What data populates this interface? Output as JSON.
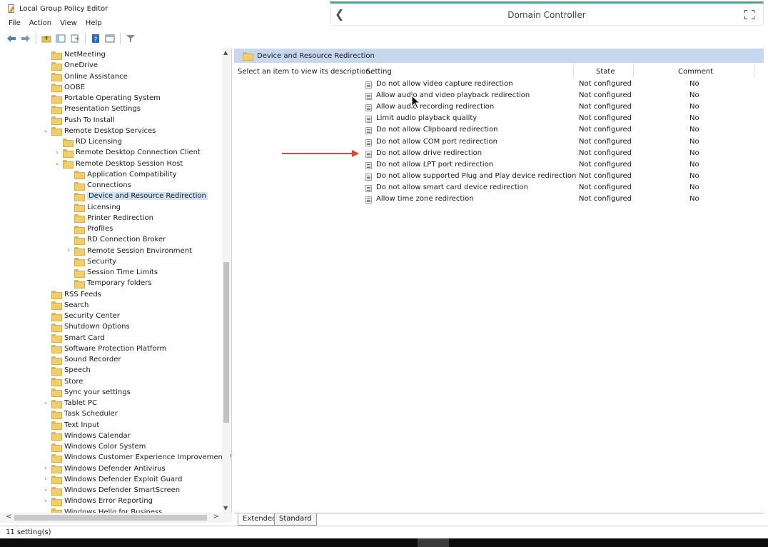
{
  "window": {
    "title": "Local Group Policy Editor"
  },
  "menu": [
    "File",
    "Action",
    "View",
    "Help"
  ],
  "remote_session": {
    "title": "Domain Controller"
  },
  "tree": {
    "items": [
      {
        "label": "NetMeeting",
        "expander": ""
      },
      {
        "label": "OneDrive",
        "expander": ""
      },
      {
        "label": "Online Assistance",
        "expander": ""
      },
      {
        "label": "OOBE",
        "expander": ""
      },
      {
        "label": "Portable Operating System",
        "expander": ""
      },
      {
        "label": "Presentation Settings",
        "expander": ""
      },
      {
        "label": "Push To Install",
        "expander": ""
      },
      {
        "label": "Remote Desktop Services",
        "expander": "⌄"
      },
      {
        "label": "RD Licensing",
        "expander": ""
      },
      {
        "label": "Remote Desktop Connection Client",
        "expander": "›"
      },
      {
        "label": "Remote Desktop Session Host",
        "expander": "⌄"
      },
      {
        "label": "Application Compatibility",
        "expander": ""
      },
      {
        "label": "Connections",
        "expander": ""
      },
      {
        "label": "Device and Resource Redirection",
        "expander": "",
        "selected": true
      },
      {
        "label": "Licensing",
        "expander": ""
      },
      {
        "label": "Printer Redirection",
        "expander": ""
      },
      {
        "label": "Profiles",
        "expander": ""
      },
      {
        "label": "RD Connection Broker",
        "expander": ""
      },
      {
        "label": "Remote Session Environment",
        "expander": "›"
      },
      {
        "label": "Security",
        "expander": ""
      },
      {
        "label": "Session Time Limits",
        "expander": ""
      },
      {
        "label": "Temporary folders",
        "expander": ""
      },
      {
        "label": "RSS Feeds",
        "expander": ""
      },
      {
        "label": "Search",
        "expander": ""
      },
      {
        "label": "Security Center",
        "expander": ""
      },
      {
        "label": "Shutdown Options",
        "expander": ""
      },
      {
        "label": "Smart Card",
        "expander": ""
      },
      {
        "label": "Software Protection Platform",
        "expander": ""
      },
      {
        "label": "Sound Recorder",
        "expander": ""
      },
      {
        "label": "Speech",
        "expander": ""
      },
      {
        "label": "Store",
        "expander": ""
      },
      {
        "label": "Sync your settings",
        "expander": ""
      },
      {
        "label": "Tablet PC",
        "expander": "›"
      },
      {
        "label": "Task Scheduler",
        "expander": ""
      },
      {
        "label": "Text Input",
        "expander": ""
      },
      {
        "label": "Windows Calendar",
        "expander": ""
      },
      {
        "label": "Windows Color System",
        "expander": ""
      },
      {
        "label": "Windows Customer Experience Improvement Prc",
        "expander": ""
      },
      {
        "label": "Windows Defender Antivirus",
        "expander": "›"
      },
      {
        "label": "Windows Defender Exploit Guard",
        "expander": "›"
      },
      {
        "label": "Windows Defender SmartScreen",
        "expander": "›"
      },
      {
        "label": "Windows Error Reporting",
        "expander": "›"
      },
      {
        "label": "Windows Hello for Business",
        "expander": ""
      }
    ]
  },
  "details": {
    "header": "Device and Resource Redirection",
    "description": "Select an item to view its description.",
    "columns": {
      "setting": "Setting",
      "state": "State",
      "comment": "Comment"
    },
    "settings": [
      {
        "name": "Do not allow video capture redirection",
        "state": "Not configured",
        "comment": "No"
      },
      {
        "name": "Allow audio and video playback redirection",
        "state": "Not configured",
        "comment": "No"
      },
      {
        "name": "Allow audio recording redirection",
        "state": "Not configured",
        "comment": "No"
      },
      {
        "name": "Limit audio playback quality",
        "state": "Not configured",
        "comment": "No"
      },
      {
        "name": "Do not allow Clipboard redirection",
        "state": "Not configured",
        "comment": "No"
      },
      {
        "name": "Do not allow COM port redirection",
        "state": "Not configured",
        "comment": "No"
      },
      {
        "name": "Do not allow drive redirection",
        "state": "Not configured",
        "comment": "No"
      },
      {
        "name": "Do not allow LPT port redirection",
        "state": "Not configured",
        "comment": "No"
      },
      {
        "name": "Do not allow supported Plug and Play device redirection",
        "state": "Not configured",
        "comment": "No"
      },
      {
        "name": "Do not allow smart card device redirection",
        "state": "Not configured",
        "comment": "No"
      },
      {
        "name": "Allow time zone redirection",
        "state": "Not configured",
        "comment": "No"
      }
    ]
  },
  "tabs": [
    "Extended",
    "Standard"
  ],
  "status": {
    "text": "11 setting(s)"
  },
  "colors": {
    "header_band": "#c7d8ee",
    "accent_bar": "#5e9a8e",
    "arrow": "#e8412c",
    "selection": "#cce4f7"
  }
}
